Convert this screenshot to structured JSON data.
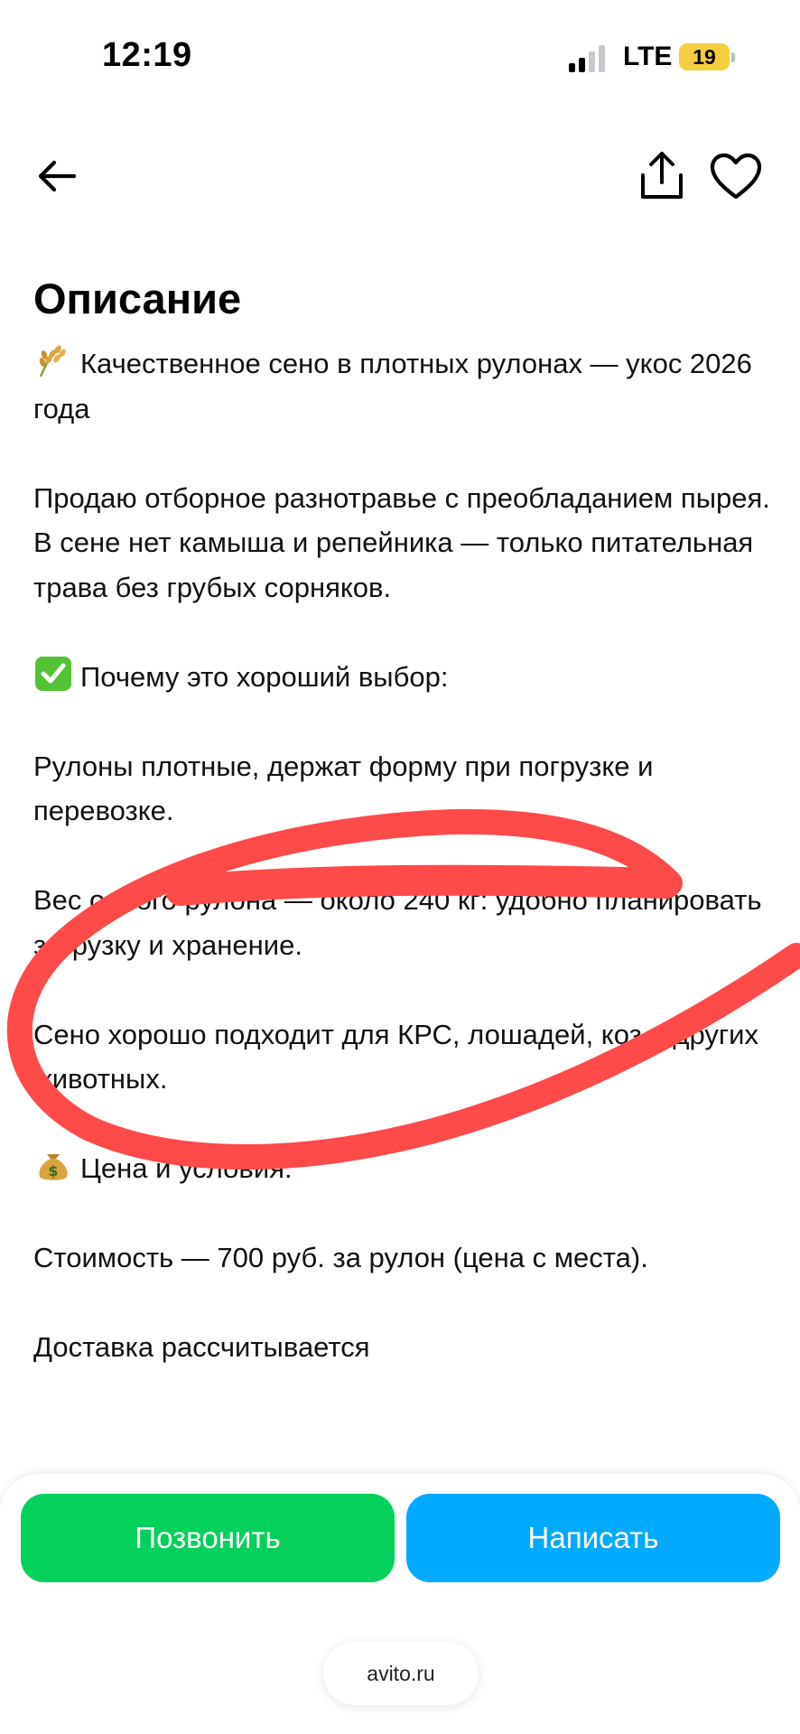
{
  "status_bar": {
    "time": "12:19",
    "network": "LTE",
    "battery": "19"
  },
  "nav": {
    "back_icon": "arrow-left-icon",
    "share_icon": "share-icon",
    "favorite_icon": "heart-icon"
  },
  "description": {
    "title": "Описание",
    "paragraphs": [
      "Качественное сено в плотных рулонах — укос 2026 года",
      "Продаю отборное разнотравье с преобладанием пырея. В сене нет камыша и репейника — только питательная трава без грубых сорняков.",
      "Почему это хороший выбор:",
      "Рулоны плотные, держат форму при погрузке и перевозке.",
      "Вес одного рулона — около 240 кг: удобно планировать загрузку и хранение.",
      "Сено хорошо подходит для КРС, лошадей, коз и других животных.",
      "Цена и условия:",
      "Стоимость — 700 руб. за рулон (цена с места).",
      "Доставка рассчитывается"
    ],
    "emoji": [
      "sheaf-of-rice-icon",
      "check-mark-icon",
      "money-bag-icon"
    ]
  },
  "actions": {
    "call_label": "Позвонить",
    "write_label": "Написать"
  },
  "browser": {
    "url": "avito.ru"
  },
  "colors": {
    "call_button": "#04d15b",
    "write_button": "#00aaff",
    "annotation": "#ff4a4a"
  }
}
